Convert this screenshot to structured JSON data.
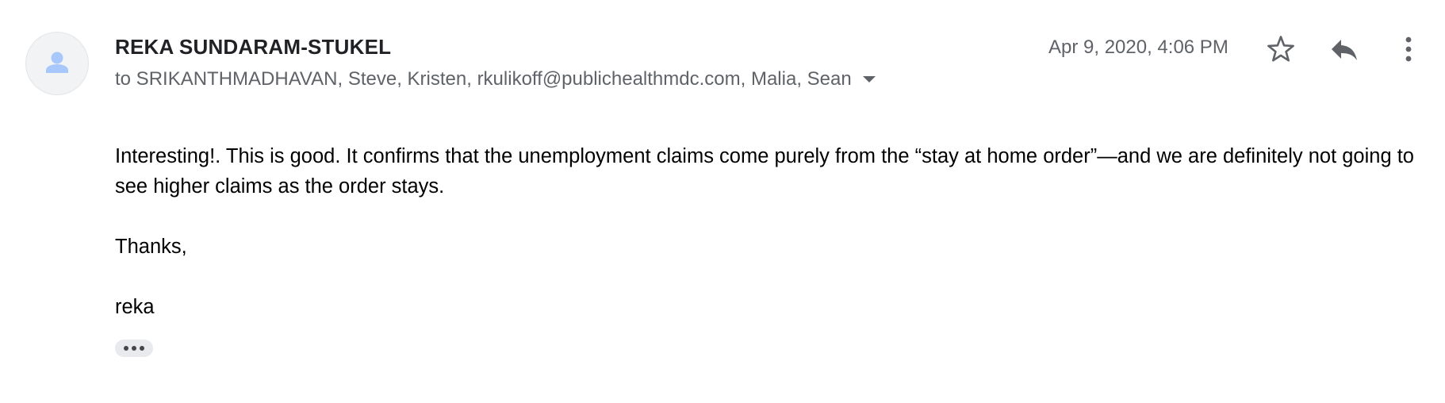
{
  "email": {
    "sender_name": "REKA SUNDARAM-STUKEL",
    "recipients_line": "to SRIKANTHMADHAVAN, Steve, Kristen, rkulikoff@publichealthmdc.com, Malia, Sean",
    "date": "Apr 9, 2020, 4:06 PM",
    "body": {
      "paragraph_1": "Interesting!. This is good. It confirms that the unemployment claims come purely from the “stay at home order”—and we are definitely not going to see higher claims as the order stays.",
      "paragraph_2": "Thanks,",
      "paragraph_3": "reka"
    }
  },
  "icons": {
    "avatar": "person-icon",
    "recipients_toggle": "caret-down-icon",
    "star": "star-outline-icon",
    "reply": "reply-icon",
    "more": "more-vert-icon",
    "trimmed": "ellipsis-icon"
  },
  "colors": {
    "avatar_bg": "#f1f3f4",
    "avatar_icon": "#a8c7fa",
    "secondary_text": "#5f6368",
    "icon_gray": "#5f6368"
  }
}
